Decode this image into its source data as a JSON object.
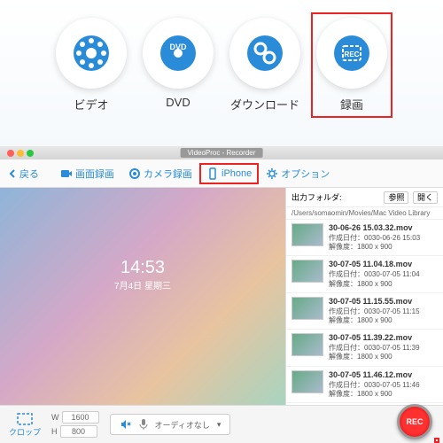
{
  "features": [
    {
      "label": "ビデオ"
    },
    {
      "label": "DVD"
    },
    {
      "label": "ダウンロード"
    },
    {
      "label": "録画"
    }
  ],
  "window": {
    "title": "VideoProc - Recorder",
    "back": "戻る"
  },
  "toolbar": {
    "screen": "画面録画",
    "camera": "カメラ録画",
    "iphone": "iPhone",
    "option": "オプション"
  },
  "preview": {
    "time": "14:53",
    "date": "7月4日 星期三"
  },
  "sidebar": {
    "title": "出力フォルダ:",
    "btn1": "参照",
    "btn2": "開く",
    "path": "/Users/somaomin/Movies/Mac Video Library",
    "files": [
      {
        "name": "30-06-26 15.03.32.mov",
        "date": "作成日付：0030-06-26 15:03",
        "res": "解像度：1800 x 900"
      },
      {
        "name": "30-07-05 11.04.18.mov",
        "date": "作成日付：0030-07-05 11:04",
        "res": "解像度：1800 x 900"
      },
      {
        "name": "30-07-05 11.15.55.mov",
        "date": "作成日付：0030-07-05 11:15",
        "res": "解像度：1800 x 900"
      },
      {
        "name": "30-07-05 11.39.22.mov",
        "date": "作成日付：0030-07-05 11:39",
        "res": "解像度：1800 x 900"
      },
      {
        "name": "30-07-05 11.46.12.mov",
        "date": "作成日付：0030-07-05 11:46",
        "res": "解像度：1800 x 900"
      }
    ]
  },
  "bottom": {
    "crop": "クロップ",
    "w": "1600",
    "h": "800",
    "audio": "オーディオなし",
    "rec": "REC"
  }
}
